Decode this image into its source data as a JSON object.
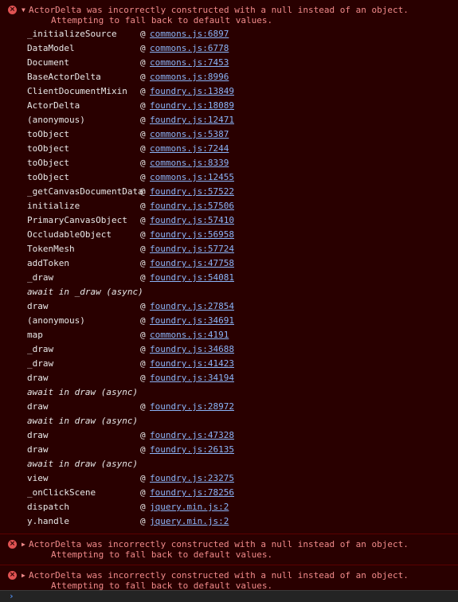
{
  "errors": [
    {
      "line1": "ActorDelta was incorrectly constructed with a null instead of an object.",
      "line2": "Attempting to fall back to default values.",
      "expanded": true,
      "stack": [
        {
          "fn": "_initializeSource",
          "link": "commons.js:6897"
        },
        {
          "fn": "DataModel",
          "link": "commons.js:6778"
        },
        {
          "fn": "Document",
          "link": "commons.js:7453"
        },
        {
          "fn": "BaseActorDelta",
          "link": "commons.js:8996"
        },
        {
          "fn": "ClientDocumentMixin",
          "link": "foundry.js:13849"
        },
        {
          "fn": "ActorDelta",
          "link": "foundry.js:18089"
        },
        {
          "fn": "(anonymous)",
          "link": "foundry.js:12471"
        },
        {
          "fn": "toObject",
          "link": "commons.js:5387"
        },
        {
          "fn": "toObject",
          "link": "commons.js:7244"
        },
        {
          "fn": "toObject",
          "link": "commons.js:8339"
        },
        {
          "fn": "toObject",
          "link": "commons.js:12455"
        },
        {
          "fn": "_getCanvasDocumentData",
          "link": "foundry.js:57522"
        },
        {
          "fn": "initialize",
          "link": "foundry.js:57506"
        },
        {
          "fn": "PrimaryCanvasObject",
          "link": "foundry.js:57410"
        },
        {
          "fn": "OccludableObject",
          "link": "foundry.js:56958"
        },
        {
          "fn": "TokenMesh",
          "link": "foundry.js:57724"
        },
        {
          "fn": "addToken",
          "link": "foundry.js:47758"
        },
        {
          "fn": "_draw",
          "link": "foundry.js:54081"
        },
        {
          "async": "await in _draw (async)"
        },
        {
          "fn": "draw",
          "link": "foundry.js:27854"
        },
        {
          "fn": "(anonymous)",
          "link": "foundry.js:34691"
        },
        {
          "fn": "map",
          "link": "commons.js:4191"
        },
        {
          "fn": "_draw",
          "link": "foundry.js:34688"
        },
        {
          "fn": "_draw",
          "link": "foundry.js:41423"
        },
        {
          "fn": "draw",
          "link": "foundry.js:34194"
        },
        {
          "async": "await in draw (async)"
        },
        {
          "fn": "draw",
          "link": "foundry.js:28972"
        },
        {
          "async": "await in draw (async)"
        },
        {
          "fn": "draw",
          "link": "foundry.js:47328"
        },
        {
          "fn": "draw",
          "link": "foundry.js:26135"
        },
        {
          "async": "await in draw (async)"
        },
        {
          "fn": "view",
          "link": "foundry.js:23275"
        },
        {
          "fn": "_onClickScene",
          "link": "foundry.js:78256"
        },
        {
          "fn": "dispatch",
          "link": "jquery.min.js:2"
        },
        {
          "fn": "y.handle",
          "link": "jquery.min.js:2"
        }
      ]
    },
    {
      "line1": "ActorDelta was incorrectly constructed with a null instead of an object.",
      "line2": "Attempting to fall back to default values.",
      "expanded": false
    },
    {
      "line1": "ActorDelta was incorrectly constructed with a null instead of an object.",
      "line2": "Attempting to fall back to default values.",
      "expanded": false
    }
  ],
  "at_symbol": "@",
  "icons": {
    "error": "error-circle-icon",
    "expand": "expand-triangle-icon",
    "prompt": "prompt-caret-icon"
  },
  "colors": {
    "background": "#290000",
    "error_text": "#f08a8a",
    "link": "#8ab4f8",
    "divider": "#5c0000"
  }
}
